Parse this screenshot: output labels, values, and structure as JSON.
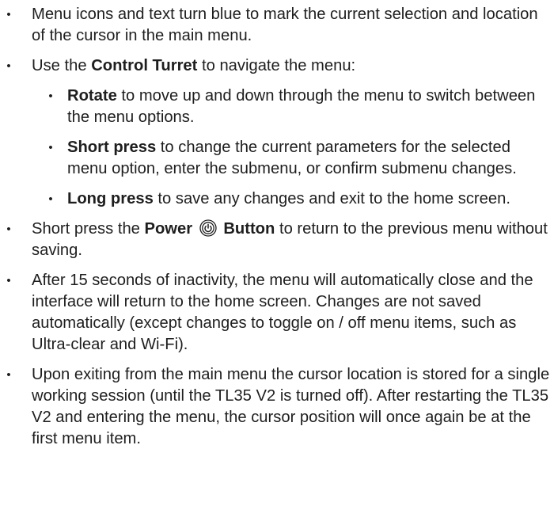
{
  "items": [
    {
      "text": "Menu icons and text turn blue to mark the current selection and location of the cursor in the main menu."
    },
    {
      "pre": "Use the ",
      "bold": "Control Turret",
      "post": " to navigate the menu:",
      "subitems": [
        {
          "bold": "Rotate",
          "post": " to move up and down through the menu to switch between the menu options."
        },
        {
          "bold": "Short press",
          "post": " to change the current parameters for the selected menu option, enter the submenu, or confirm submenu changes."
        },
        {
          "bold": "Long press",
          "post": " to save any changes and exit to the home screen."
        }
      ]
    },
    {
      "pre": "Short press the ",
      "bold1": "Power",
      "bold2": "Button",
      "post": " to return to the previous menu without saving."
    },
    {
      "text": "After 15 seconds of inactivity, the menu will automatically close and the interface will return to the home screen. Changes are not saved automatically (except changes to toggle on / off menu items, such as Ultra-clear and Wi-Fi)."
    },
    {
      "text": "Upon exiting from the main menu the cursor location is stored for a single working session (until the TL35 V2 is turned off). After restarting the TL35 V2 and entering the menu, the cursor position will once again be at the first menu item."
    }
  ],
  "bullet_char": "•",
  "icons": {
    "power": "power-button-icon"
  }
}
